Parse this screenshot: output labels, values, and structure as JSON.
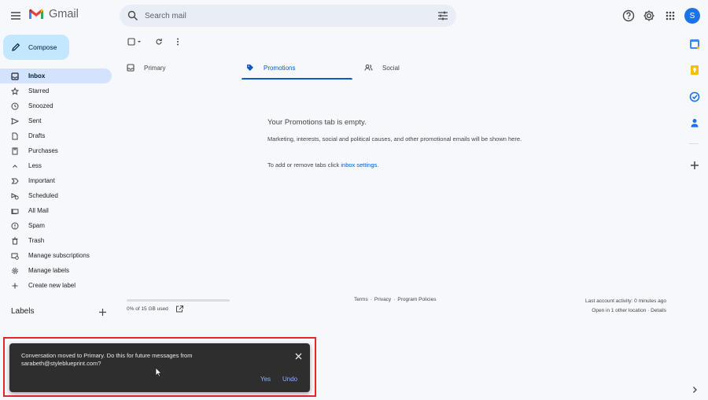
{
  "header": {
    "app_name": "Gmail",
    "search_placeholder": "Search mail",
    "avatar_initial": "S",
    "icons": [
      "menu-icon",
      "gmail-logo",
      "search-icon",
      "tune-icon",
      "help-icon",
      "settings-icon",
      "apps-icon"
    ]
  },
  "compose": {
    "label": "Compose"
  },
  "sidebar": {
    "items": [
      {
        "label": "Inbox",
        "icon": "inbox-icon",
        "active": true
      },
      {
        "label": "Starred",
        "icon": "star-icon"
      },
      {
        "label": "Snoozed",
        "icon": "clock-icon"
      },
      {
        "label": "Sent",
        "icon": "send-icon"
      },
      {
        "label": "Drafts",
        "icon": "draft-icon"
      },
      {
        "label": "Purchases",
        "icon": "tag-icon"
      },
      {
        "label": "Less",
        "icon": "chevron-up-icon"
      },
      {
        "label": "Important",
        "icon": "important-icon"
      },
      {
        "label": "Scheduled",
        "icon": "scheduled-icon"
      },
      {
        "label": "All Mail",
        "icon": "all-mail-icon"
      },
      {
        "label": "Spam",
        "icon": "spam-icon"
      },
      {
        "label": "Trash",
        "icon": "trash-icon"
      },
      {
        "label": "Manage subscriptions",
        "icon": "subscriptions-icon"
      },
      {
        "label": "Manage labels",
        "icon": "gear-icon"
      },
      {
        "label": "Create new label",
        "icon": "plus-icon"
      }
    ],
    "labels_title": "Labels"
  },
  "tabs": [
    {
      "label": "Primary",
      "icon": "inbox-icon"
    },
    {
      "label": "Promotions",
      "icon": "tag-icon",
      "active": true
    },
    {
      "label": "Social",
      "icon": "people-icon"
    }
  ],
  "empty_state": {
    "title": "Your Promotions tab is empty.",
    "description": "Marketing, interests, social and political causes, and other promotional emails will be shown here.",
    "tabs_text": "To add or remove tabs click ",
    "tabs_link": "inbox settings",
    "tabs_suffix": "."
  },
  "footer": {
    "storage": "0% of 15 GB used",
    "storage_used_fraction": 0,
    "terms": "Terms",
    "privacy": "Privacy",
    "program_policies": "Program Policies",
    "separator": "·",
    "last_activity": "Last account activity: 0 minutes ago",
    "open_in": "Open in 1 other location",
    "details": "Details"
  },
  "side_panel": {
    "apps": [
      "calendar-icon",
      "keep-icon",
      "tasks-icon",
      "contacts-icon",
      "add-icon"
    ]
  },
  "toast": {
    "message": "Conversation moved to Primary. Do this for future messages from sarabeth@styleblueprint.com?",
    "yes": "Yes",
    "undo": "Undo"
  },
  "colors": {
    "accent": "#0b57d0",
    "compose_bg": "#c2e7ff",
    "active_nav": "#d3e3fd",
    "highlight_box": "#e5262b",
    "toast_bg": "#2e2e2f",
    "toast_link": "#8ab4f8"
  }
}
